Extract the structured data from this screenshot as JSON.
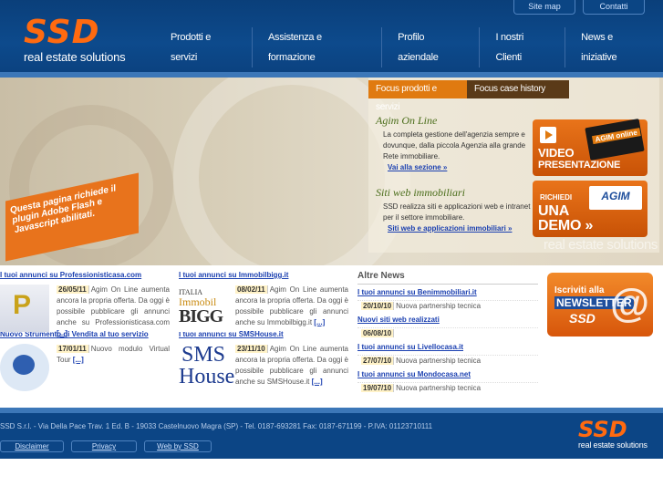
{
  "header": {
    "logo_text": "SSD",
    "logo_sub": "real estate solutions",
    "top_links": [
      "Site map",
      "Contatti"
    ],
    "nav": [
      "Prodotti e servizi",
      "Assistenza e formazione",
      "Profilo aziendale",
      "I nostri Clienti",
      "News e iniziative"
    ]
  },
  "banner": {
    "flash_note": "Questa pagina richiede il plugin Adobe Flash e Javascript abilitati.",
    "tabs": [
      "Focus prodotti e servizi",
      "Focus case history"
    ],
    "blocks": [
      {
        "title": "Agim On Line",
        "text": "La completa gestione dell'agenzia sempre e dovunque, dalla piccola Agenzia alla grande Rete immobiliare.",
        "link": "Vai alla sezione »"
      },
      {
        "title": "Siti web immobiliari",
        "text": "SSD realizza siti e applicazioni web e intranet per il settore immobiliare.",
        "link": "Siti web e applicazioni immobiliari »"
      }
    ],
    "promo_video": {
      "line1": "VIDEO",
      "line2": "PRESENTAZIONE",
      "badge": "AGIM online"
    },
    "promo_demo": {
      "line1": "RICHIEDI",
      "line2": "UNA",
      "line3": "DEMO »",
      "badge": "AGIM"
    },
    "watermark": "real estate solutions"
  },
  "col1": {
    "title": "I tuoi annunci su Professionisticasa.com",
    "item1": {
      "date": "26/05/11",
      "text": "Agim On Line aumenta ancora la propria offerta. Da oggi è possibile pubblicare gli annunci anche su Professionisticasa.com",
      "more": "[...]"
    },
    "title2": "Nuovo Strumento di Vendita al tuo servizio",
    "item2": {
      "date": "17/01/11",
      "text": "Nuovo modulo Virtual Tour",
      "more": "[...]"
    }
  },
  "col2": {
    "title": "I tuoi annunci su Immobilbigg.it",
    "item1": {
      "date": "08/02/11",
      "text": "Agim On Line aumenta ancora la propria offerta. Da oggi è possibile pubblicare gli annunci anche su Immobilbigg.it",
      "more": "[...]",
      "img": {
        "l1": "ITALIA",
        "l2": "Immobil",
        "l3": "BIGG"
      }
    },
    "title2": "I tuoi annunci su SMSHouse.it",
    "item2": {
      "date": "23/11/10",
      "text": "Agim On Line aumenta ancora la propria offerta. Da oggi è possibile pubblicare gli annunci anche su SMSHouse.it",
      "more": "[...]",
      "img": {
        "l1": "SMS",
        "l2": "House"
      }
    }
  },
  "altre": {
    "title": "Altre News",
    "items": [
      {
        "title": "I tuoi annunci su Benimmobiliari.it",
        "date": "20/10/10",
        "text": "Nuova partnership tecnica"
      },
      {
        "title": "Nuovi siti web realizzati",
        "date": "06/08/10",
        "text": ""
      },
      {
        "title": "I tuoi annunci su Livellocasa.it",
        "date": "27/07/10",
        "text": "Nuova partnership tecnica"
      },
      {
        "title": "I tuoi annunci su Mondocasa.net",
        "date": "19/07/10",
        "text": "Nuova partnership tecnica"
      }
    ]
  },
  "newsletter": {
    "l1": "Iscriviti alla",
    "l2": "NEWSLETTER",
    "l3": "SSD",
    "at": "@"
  },
  "footer": {
    "text": "SSD S.r.l. - Via Della Pace Trav. 1 Ed. B - 19033 Castelnuovo Magra (SP) - Tel. 0187-693281 Fax: 0187-671199 - P.IVA: 01123710111",
    "links": [
      "Disclaimer",
      "Privacy",
      "Web by SSD"
    ],
    "logo_text": "SSD",
    "logo_sub": "real estate solutions"
  },
  "colors": {
    "brand_orange": "#ff6a10",
    "brand_blue": "#0c4585",
    "link_blue": "#1a3fb0"
  }
}
